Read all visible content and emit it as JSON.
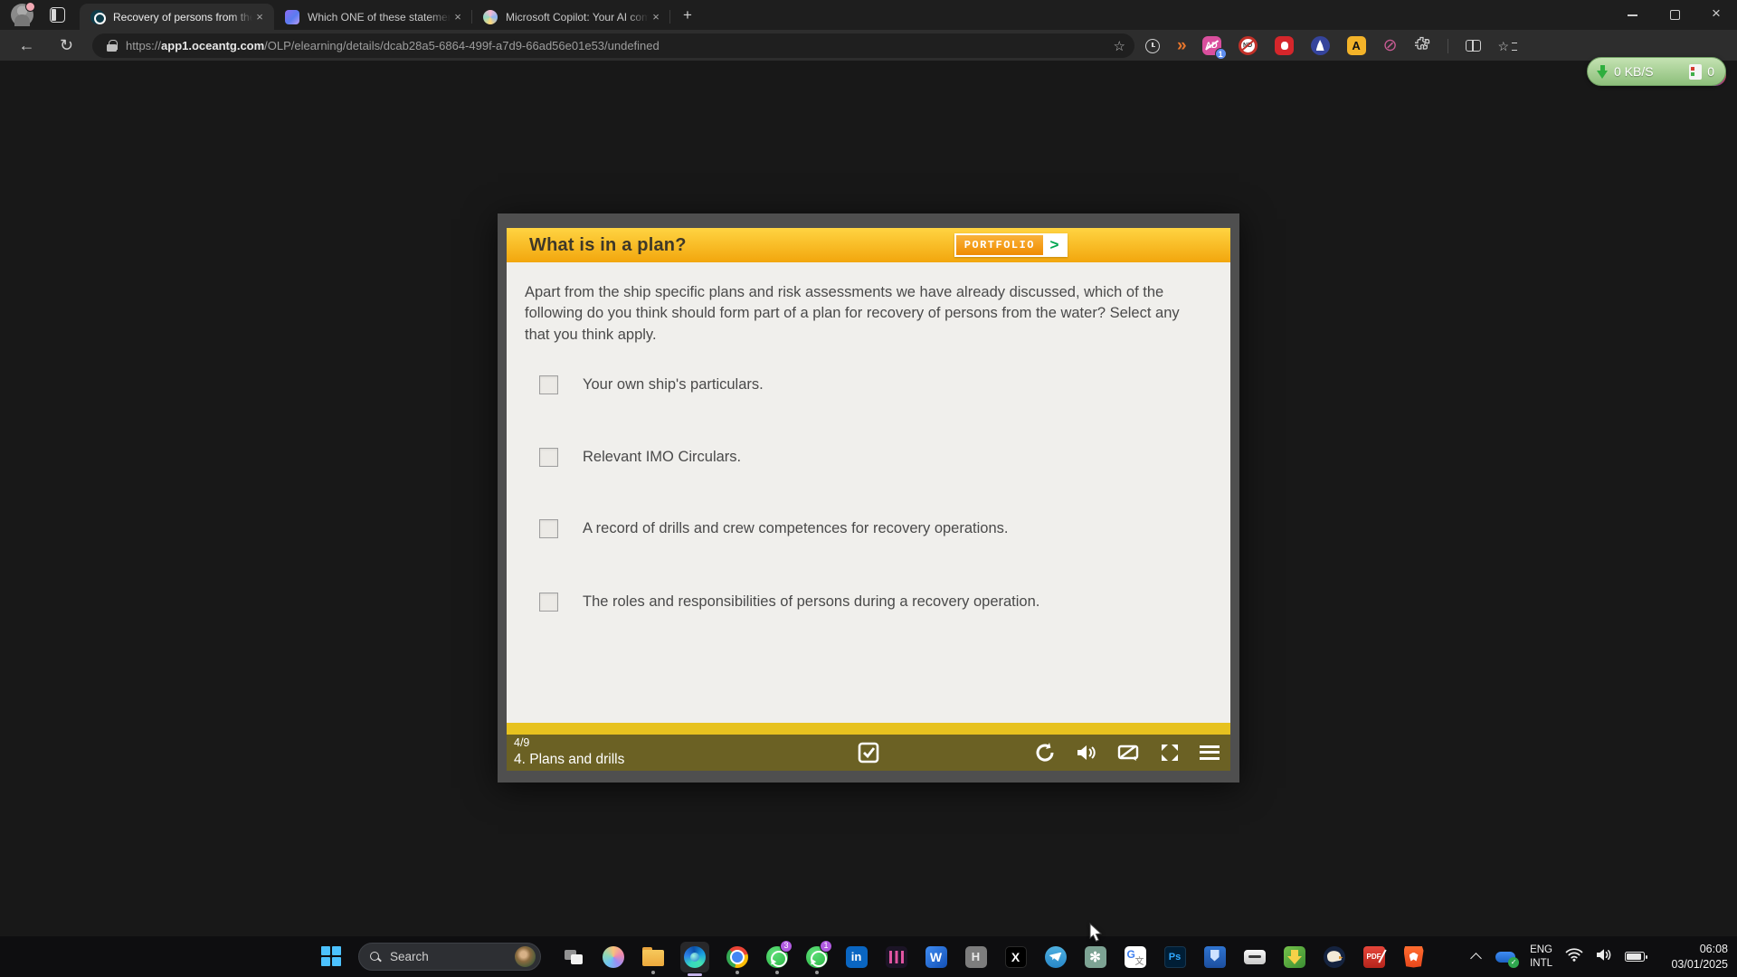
{
  "browser": {
    "tabs": [
      {
        "title": "Recovery of persons from the wat"
      },
      {
        "title": "Which ONE of these statements b"
      },
      {
        "title": "Microsoft Copilot: Your AI compa"
      }
    ],
    "url_scheme": "https://",
    "url_domain": "app1.oceantg.com",
    "url_path": "/OLP/elearning/details/dcab28a5-6864-499f-a7d9-66ad56e01e53/undefined",
    "extensions": {
      "adblock_letters": "AD",
      "adblock_badge": "1",
      "nd_letters": "ND",
      "a_letter": "A"
    },
    "idm_widget": {
      "speed": "0 KB/S",
      "count": "0"
    }
  },
  "quiz": {
    "title": "What is in a plan?",
    "portfolio": "PORTFOLIO",
    "portfolio_chevron": ">",
    "question": "Apart from the ship specific plans and risk assessments we have already discussed, which of the following do you think should form part of a plan for recovery of persons from the water? Select any that you think apply.",
    "options": [
      "Your own ship's particulars.",
      "Relevant IMO Circulars.",
      "A record of drills and crew competences for recovery operations.",
      "The roles and responsibilities of persons during a recovery operation."
    ],
    "progress": "4/9",
    "section": "4. Plans and drills"
  },
  "taskbar": {
    "search": "Search",
    "whatsapp_badge_1": "3",
    "whatsapp_badge_2": "1",
    "letters": {
      "linkedin": "in",
      "word": "W",
      "h_app": "H",
      "x_app": "X",
      "chatgpt": "✻",
      "translate_g": "G",
      "translate_cn": "文",
      "photoshop": "Ps",
      "pdf": "PDF"
    },
    "tray": {
      "lang_top": "ENG",
      "lang_bottom": "INTL",
      "time": "06:08",
      "date": "03/01/2025"
    }
  },
  "colors": {
    "header_yellow_top": "#ffd442",
    "header_yellow_bottom": "#f2a60d",
    "footer_olive": "#6b6124",
    "strip_yellow": "#e7c21f",
    "portfolio_orange": "#f08c00",
    "portfolio_green": "#00a651",
    "idm_green": "#8dbf7b",
    "edge_accent": "#c3b2e8"
  }
}
